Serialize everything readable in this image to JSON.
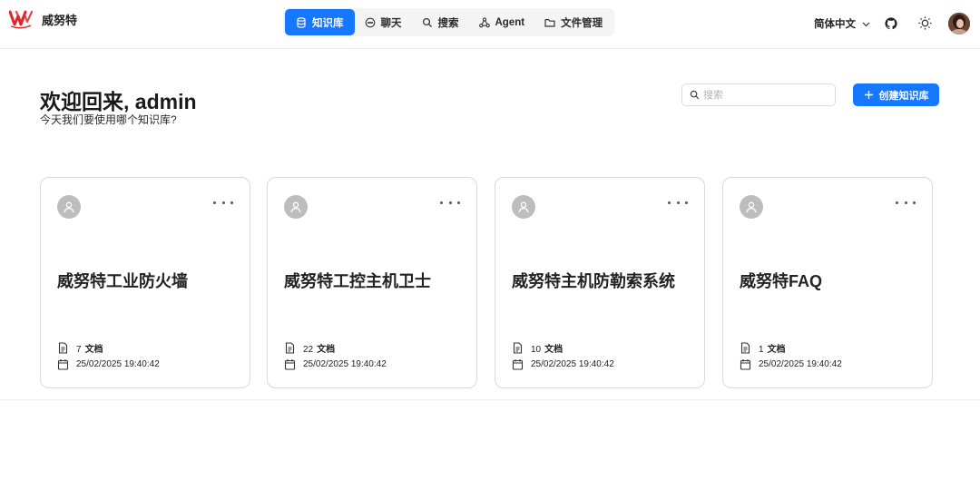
{
  "brand": {
    "name": "威努特"
  },
  "nav": {
    "items": [
      {
        "label": "知识库",
        "icon": "database-icon",
        "active": true
      },
      {
        "label": "聊天",
        "icon": "chat-icon",
        "active": false
      },
      {
        "label": "搜索",
        "icon": "search-icon",
        "active": false
      },
      {
        "label": "Agent",
        "icon": "agent-icon",
        "active": false
      },
      {
        "label": "文件管理",
        "icon": "folder-icon",
        "active": false
      }
    ]
  },
  "header": {
    "language": "简体中文"
  },
  "greeting": {
    "title": "欢迎回来, admin",
    "subtitle": "今天我们要使用哪个知识库?"
  },
  "search": {
    "placeholder": "搜索"
  },
  "create_button": {
    "label": "创建知识库"
  },
  "docs_unit": "文档",
  "cards": [
    {
      "title": "威努特工业防火墙",
      "doc_count": "7",
      "date": "25/02/2025 19:40:42"
    },
    {
      "title": "威努特工控主机卫士",
      "doc_count": "22",
      "date": "25/02/2025 19:40:42"
    },
    {
      "title": "威努特主机防勒索系统",
      "doc_count": "10",
      "date": "25/02/2025 19:40:42"
    },
    {
      "title": "威努特FAQ",
      "doc_count": "1",
      "date": "25/02/2025 19:40:42"
    }
  ],
  "colors": {
    "accent": "#1677ff",
    "brand_red": "#e0262b"
  }
}
